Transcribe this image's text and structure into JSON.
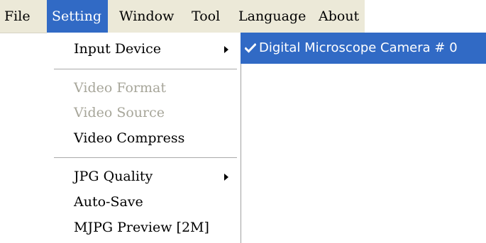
{
  "menubar": {
    "items": [
      "File",
      "Setting",
      "Window",
      "Tool",
      "Language",
      "About"
    ],
    "active_index": 1
  },
  "setting_menu": {
    "input_device": "Input Device",
    "video_format": "Video Format",
    "video_source": "Video Source",
    "video_compress": "Video Compress",
    "jpg_quality": "JPG Quality",
    "auto_save": "Auto-Save",
    "mjpg_preview": "MJPG Preview [2M]"
  },
  "input_device_submenu": {
    "items": [
      {
        "label": "Digital Microscope Camera # 0",
        "checked": true
      }
    ]
  },
  "colors": {
    "highlight": "#316ac5",
    "menubar_bg": "#ece9d8",
    "disabled_text": "#a7a69a"
  },
  "icons": {
    "submenu_arrow": "chevron-right-icon",
    "checked": "checkmark-icon"
  }
}
